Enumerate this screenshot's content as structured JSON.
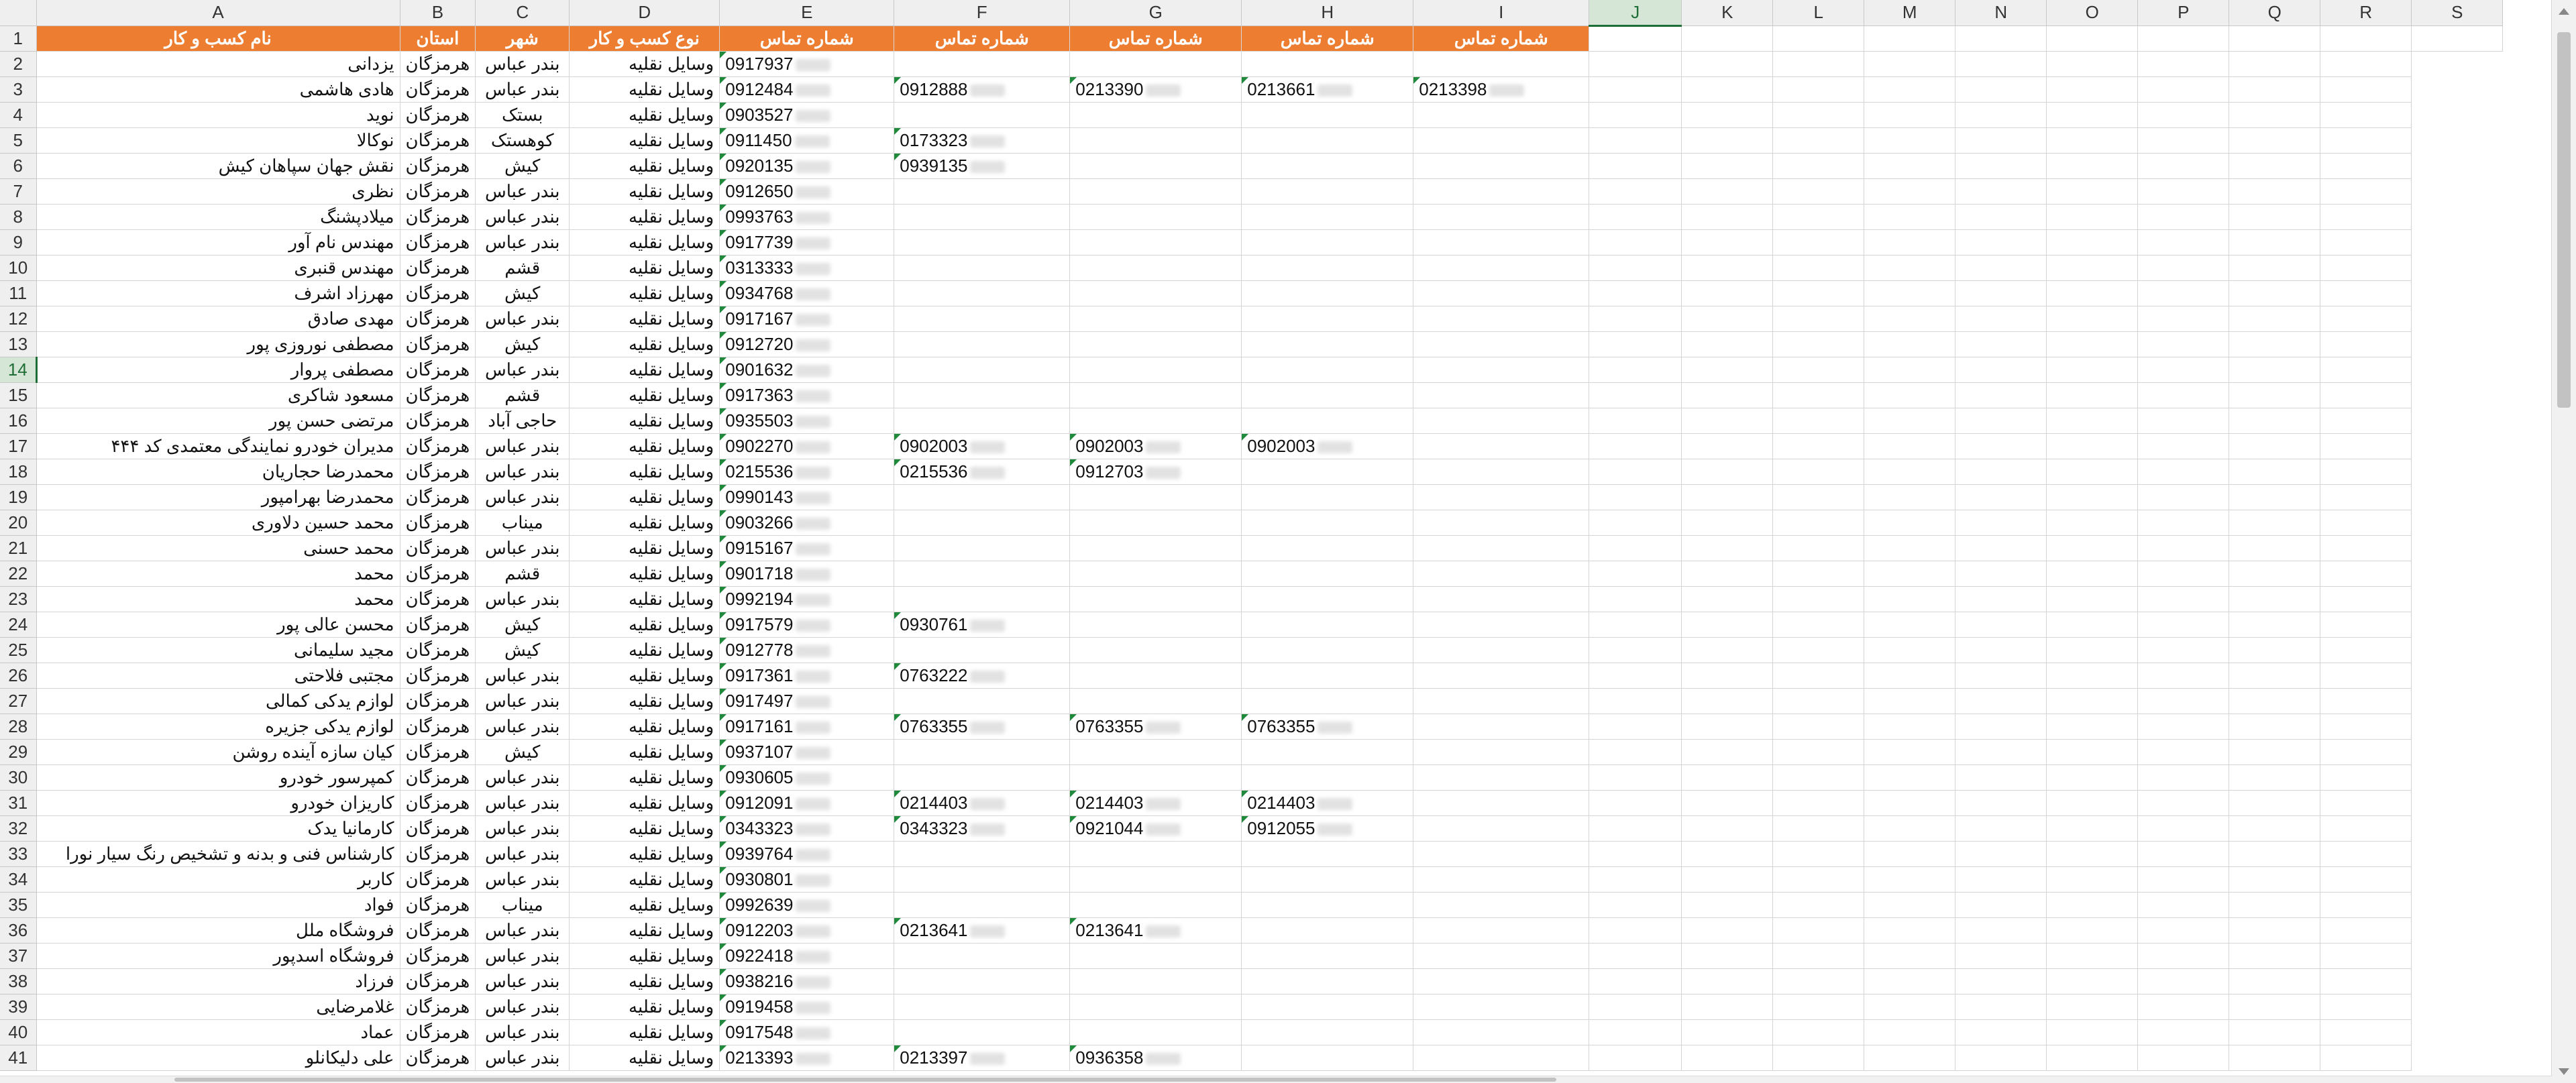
{
  "columns": [
    "A",
    "B",
    "C",
    "D",
    "E",
    "F",
    "G",
    "H",
    "I",
    "J",
    "K",
    "L",
    "M",
    "N",
    "O",
    "P",
    "Q",
    "R",
    "S"
  ],
  "selected_column": "J",
  "selected_row": "14",
  "header_row": {
    "num": "1",
    "cells": [
      "نام کسب و کار",
      "استان",
      "شهر",
      "نوع کسب و کار",
      "شماره تماس",
      "شماره تماس",
      "شماره تماس",
      "شماره تماس",
      "شماره تماس"
    ]
  },
  "rows": [
    {
      "num": "2",
      "name": "یزدانی",
      "province": "هرمزگان",
      "city": "بندر عباس",
      "type": "وسایل نقلیه",
      "phones": [
        "0917937",
        "",
        "",
        "",
        ""
      ]
    },
    {
      "num": "3",
      "name": "هادی هاشمی",
      "province": "هرمزگان",
      "city": "بندر عباس",
      "type": "وسایل نقلیه",
      "phones": [
        "0912484",
        "0912888",
        "0213390",
        "0213661",
        "0213398"
      ]
    },
    {
      "num": "4",
      "name": "نوید",
      "province": "هرمزگان",
      "city": "بستک",
      "type": "وسایل نقلیه",
      "phones": [
        "0903527",
        "",
        "",
        "",
        ""
      ]
    },
    {
      "num": "5",
      "name": "نوکالا",
      "province": "هرمزگان",
      "city": "کوهستک",
      "type": "وسایل نقلیه",
      "phones": [
        "0911450",
        "0173323",
        "",
        "",
        ""
      ]
    },
    {
      "num": "6",
      "name": "نقش جهان سپاهان کیش",
      "province": "هرمزگان",
      "city": "کیش",
      "type": "وسایل نقلیه",
      "phones": [
        "0920135",
        "0939135",
        "",
        "",
        ""
      ]
    },
    {
      "num": "7",
      "name": "نظری",
      "province": "هرمزگان",
      "city": "بندر عباس",
      "type": "وسایل نقلیه",
      "phones": [
        "0912650",
        "",
        "",
        "",
        ""
      ]
    },
    {
      "num": "8",
      "name": "میلادپشنگ",
      "province": "هرمزگان",
      "city": "بندر عباس",
      "type": "وسایل نقلیه",
      "phones": [
        "0993763",
        "",
        "",
        "",
        ""
      ]
    },
    {
      "num": "9",
      "name": "مهندس نام آور",
      "province": "هرمزگان",
      "city": "بندر عباس",
      "type": "وسایل نقلیه",
      "phones": [
        "0917739",
        "",
        "",
        "",
        ""
      ]
    },
    {
      "num": "10",
      "name": "مهندس قنبری",
      "province": "هرمزگان",
      "city": "قشم",
      "type": "وسایل نقلیه",
      "phones": [
        "0313333",
        "",
        "",
        "",
        ""
      ]
    },
    {
      "num": "11",
      "name": "مهرزاد اشرف",
      "province": "هرمزگان",
      "city": "کیش",
      "type": "وسایل نقلیه",
      "phones": [
        "0934768",
        "",
        "",
        "",
        ""
      ]
    },
    {
      "num": "12",
      "name": "مهدی صادق",
      "province": "هرمزگان",
      "city": "بندر عباس",
      "type": "وسایل نقلیه",
      "phones": [
        "0917167",
        "",
        "",
        "",
        ""
      ]
    },
    {
      "num": "13",
      "name": "مصطفی نوروزی پور",
      "province": "هرمزگان",
      "city": "کیش",
      "type": "وسایل نقلیه",
      "phones": [
        "0912720",
        "",
        "",
        "",
        ""
      ]
    },
    {
      "num": "14",
      "name": "مصطفی پروار",
      "province": "هرمزگان",
      "city": "بندر عباس",
      "type": "وسایل نقلیه",
      "phones": [
        "0901632",
        "",
        "",
        "",
        ""
      ]
    },
    {
      "num": "15",
      "name": "مسعود شاکری",
      "province": "هرمزگان",
      "city": "قشم",
      "type": "وسایل نقلیه",
      "phones": [
        "0917363",
        "",
        "",
        "",
        ""
      ]
    },
    {
      "num": "16",
      "name": "مرتضی حسن پور",
      "province": "هرمزگان",
      "city": "حاجی آباد",
      "type": "وسایل نقلیه",
      "phones": [
        "0935503",
        "",
        "",
        "",
        ""
      ]
    },
    {
      "num": "17",
      "name": "مدیران خودرو نمایندگی معتمدی کد ۴۴۴",
      "province": "هرمزگان",
      "city": "بندر عباس",
      "type": "وسایل نقلیه",
      "phones": [
        "0902270",
        "0902003",
        "0902003",
        "0902003",
        ""
      ]
    },
    {
      "num": "18",
      "name": "محمدرضا حجاریان",
      "province": "هرمزگان",
      "city": "بندر عباس",
      "type": "وسایل نقلیه",
      "phones": [
        "0215536",
        "0215536",
        "0912703",
        "",
        ""
      ]
    },
    {
      "num": "19",
      "name": "محمدرضا بهرامپور",
      "province": "هرمزگان",
      "city": "بندر عباس",
      "type": "وسایل نقلیه",
      "phones": [
        "0990143",
        "",
        "",
        "",
        ""
      ]
    },
    {
      "num": "20",
      "name": "محمد حسین دلاوری",
      "province": "هرمزگان",
      "city": "میناب",
      "type": "وسایل نقلیه",
      "phones": [
        "0903266",
        "",
        "",
        "",
        ""
      ]
    },
    {
      "num": "21",
      "name": "محمد حسنی",
      "province": "هرمزگان",
      "city": "بندر عباس",
      "type": "وسایل نقلیه",
      "phones": [
        "0915167",
        "",
        "",
        "",
        ""
      ]
    },
    {
      "num": "22",
      "name": "محمد",
      "province": "هرمزگان",
      "city": "قشم",
      "type": "وسایل نقلیه",
      "phones": [
        "0901718",
        "",
        "",
        "",
        ""
      ]
    },
    {
      "num": "23",
      "name": "محمد",
      "province": "هرمزگان",
      "city": "بندر عباس",
      "type": "وسایل نقلیه",
      "phones": [
        "0992194",
        "",
        "",
        "",
        ""
      ]
    },
    {
      "num": "24",
      "name": "محسن عالی پور",
      "province": "هرمزگان",
      "city": "کیش",
      "type": "وسایل نقلیه",
      "phones": [
        "0917579",
        "0930761",
        "",
        "",
        ""
      ]
    },
    {
      "num": "25",
      "name": "مجید سلیمانی",
      "province": "هرمزگان",
      "city": "کیش",
      "type": "وسایل نقلیه",
      "phones": [
        "0912778",
        "",
        "",
        "",
        ""
      ]
    },
    {
      "num": "26",
      "name": "مجتبی فلاحتی",
      "province": "هرمزگان",
      "city": "بندر عباس",
      "type": "وسایل نقلیه",
      "phones": [
        "0917361",
        "0763222",
        "",
        "",
        ""
      ]
    },
    {
      "num": "27",
      "name": "لوازم یدکی کمالی",
      "province": "هرمزگان",
      "city": "بندر عباس",
      "type": "وسایل نقلیه",
      "phones": [
        "0917497",
        "",
        "",
        "",
        ""
      ]
    },
    {
      "num": "28",
      "name": "لوازم یدکی جزیره",
      "province": "هرمزگان",
      "city": "بندر عباس",
      "type": "وسایل نقلیه",
      "phones": [
        "0917161",
        "0763355",
        "0763355",
        "0763355",
        ""
      ]
    },
    {
      "num": "29",
      "name": "کیان سازه آینده روشن",
      "province": "هرمزگان",
      "city": "کیش",
      "type": "وسایل نقلیه",
      "phones": [
        "0937107",
        "",
        "",
        "",
        ""
      ]
    },
    {
      "num": "30",
      "name": "کمپرسور خودرو",
      "province": "هرمزگان",
      "city": "بندر عباس",
      "type": "وسایل نقلیه",
      "phones": [
        "0930605",
        "",
        "",
        "",
        ""
      ]
    },
    {
      "num": "31",
      "name": "کاریزان خودرو",
      "province": "هرمزگان",
      "city": "بندر عباس",
      "type": "وسایل نقلیه",
      "phones": [
        "0912091",
        "0214403",
        "0214403",
        "0214403",
        ""
      ]
    },
    {
      "num": "32",
      "name": "کارمانیا یدک",
      "province": "هرمزگان",
      "city": "بندر عباس",
      "type": "وسایل نقلیه",
      "phones": [
        "0343323",
        "0343323",
        "0921044",
        "0912055",
        ""
      ]
    },
    {
      "num": "33",
      "name": "کارشناس فنی و بدنه و تشخیص رنگ سیار نورا",
      "province": "هرمزگان",
      "city": "بندر عباس",
      "type": "وسایل نقلیه",
      "phones": [
        "0939764",
        "",
        "",
        "",
        ""
      ]
    },
    {
      "num": "34",
      "name": "کاربر",
      "province": "هرمزگان",
      "city": "بندر عباس",
      "type": "وسایل نقلیه",
      "phones": [
        "0930801",
        "",
        "",
        "",
        ""
      ]
    },
    {
      "num": "35",
      "name": "فواد",
      "province": "هرمزگان",
      "city": "میناب",
      "type": "وسایل نقلیه",
      "phones": [
        "0992639",
        "",
        "",
        "",
        ""
      ]
    },
    {
      "num": "36",
      "name": "فروشگاه ملل",
      "province": "هرمزگان",
      "city": "بندر عباس",
      "type": "وسایل نقلیه",
      "phones": [
        "0912203",
        "0213641",
        "0213641",
        "",
        ""
      ]
    },
    {
      "num": "37",
      "name": "فروشگاه اسدپور",
      "province": "هرمزگان",
      "city": "بندر عباس",
      "type": "وسایل نقلیه",
      "phones": [
        "0922418",
        "",
        "",
        "",
        ""
      ]
    },
    {
      "num": "38",
      "name": "فرزاد",
      "province": "هرمزگان",
      "city": "بندر عباس",
      "type": "وسایل نقلیه",
      "phones": [
        "0938216",
        "",
        "",
        "",
        ""
      ]
    },
    {
      "num": "39",
      "name": "غلامرضایی",
      "province": "هرمزگان",
      "city": "بندر عباس",
      "type": "وسایل نقلیه",
      "phones": [
        "0919458",
        "",
        "",
        "",
        ""
      ]
    },
    {
      "num": "40",
      "name": "عماد",
      "province": "هرمزگان",
      "city": "بندر عباس",
      "type": "وسایل نقلیه",
      "phones": [
        "0917548",
        "",
        "",
        "",
        ""
      ]
    },
    {
      "num": "41",
      "name": "علی دلیکانلو",
      "province": "هرمزگان",
      "city": "بندر عباس",
      "type": "وسایل نقلیه",
      "phones": [
        "0213393",
        "0213397",
        "0936358",
        "",
        ""
      ]
    }
  ]
}
